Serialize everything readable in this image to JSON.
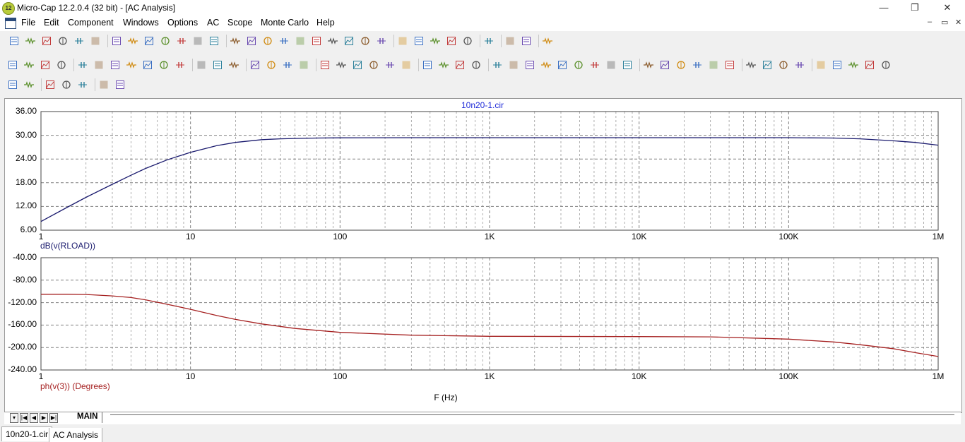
{
  "window": {
    "title": "Micro-Cap 12.2.0.4 (32 bit) - [AC Analysis]",
    "app_badge": "12"
  },
  "window_controls": {
    "minimize": "—",
    "maximize": "❐",
    "close": "✕"
  },
  "menu": {
    "items": [
      "File",
      "Edit",
      "Component",
      "Windows",
      "Options",
      "AC",
      "Scope",
      "Monte Carlo",
      "Help"
    ]
  },
  "mdi_controls": {
    "minimize": "–",
    "restore": "▭",
    "close": "✕"
  },
  "toolbar_icons": {
    "row1": [
      "new",
      "open",
      "save",
      "revert",
      "print-preview",
      "print",
      "undo",
      "redo",
      "cut",
      "copy",
      "paste",
      "delete",
      "select-all",
      "ground",
      "resistor",
      "capacitor",
      "inductor",
      "diode",
      "transistor",
      "opamp",
      "switch",
      "battery",
      "source",
      "component-list",
      "tile-horizontal",
      "tile-vertical",
      "cascade",
      "window-list",
      "calculator",
      "notes",
      "find",
      "help"
    ],
    "row2": [
      "select",
      "pan",
      "component",
      "info",
      "graph",
      "text-mode",
      "wire",
      "bus",
      "flag",
      "text",
      "paste-special",
      "run",
      "stop",
      "pause",
      "cursor-left",
      "cursor-right",
      "frame",
      "grid",
      "plot-1",
      "plot-2",
      "plot-3",
      "plot-4",
      "page-1",
      "page-2",
      "zoom-fit",
      "zoom-in-region",
      "zoom-out-region",
      "zoom-in-all",
      "properties",
      "peak",
      "valley",
      "high",
      "low",
      "inflection",
      "global-high",
      "global-low",
      "slope",
      "sep",
      "tag-v",
      "tag-h",
      "tag-point",
      "tag-text",
      "scale",
      "axis-1",
      "axis-2",
      "axis-3",
      "zoom-in",
      "zoom-out",
      "zoom-plot",
      "layout",
      "font",
      "color"
    ],
    "row3": [
      "align-left",
      "align-center",
      "align-right",
      "align-top",
      "align-middle",
      "align-bottom",
      "distribute"
    ]
  },
  "plot_title": "10n20-1.cir",
  "chart_data": [
    {
      "type": "line",
      "xscale": "log",
      "xlim": [
        1,
        1000000
      ],
      "ylim": [
        6,
        36
      ],
      "yticks": [
        "36.00",
        "30.00",
        "24.00",
        "18.00",
        "12.00",
        "6.00"
      ],
      "xticks": [
        "1",
        "10",
        "100",
        "1K",
        "10K",
        "100K",
        "1M"
      ],
      "ylabel": "dB(v(RLOAD))",
      "grid": true,
      "series": [
        {
          "name": "dB(v(RLOAD))",
          "color": "#1a1a6e",
          "x": [
            1,
            1.5,
            2,
            3,
            4,
            5,
            7,
            10,
            15,
            20,
            30,
            40,
            50,
            70,
            100,
            300,
            1000,
            10000,
            100000,
            200000,
            300000,
            500000,
            700000,
            1000000
          ],
          "y": [
            8.2,
            11.8,
            14.3,
            17.6,
            19.9,
            21.6,
            23.8,
            25.7,
            27.4,
            28.2,
            28.9,
            29.1,
            29.2,
            29.3,
            29.35,
            29.4,
            29.4,
            29.4,
            29.4,
            29.3,
            29.1,
            28.6,
            28.2,
            27.5
          ]
        }
      ]
    },
    {
      "type": "line",
      "xscale": "log",
      "xlim": [
        1,
        1000000
      ],
      "ylim": [
        -240,
        -40
      ],
      "yticks": [
        "-40.00",
        "-80.00",
        "-120.00",
        "-160.00",
        "-200.00",
        "-240.00"
      ],
      "xticks": [
        "1",
        "10",
        "100",
        "1K",
        "10K",
        "100K",
        "1M"
      ],
      "xlabel": "F (Hz)",
      "ylabel": "ph(v(3)) (Degrees)",
      "grid": true,
      "series": [
        {
          "name": "ph(v(3)) (Degrees)",
          "color": "#a52020",
          "x": [
            1,
            1.5,
            2,
            3,
            4,
            5,
            7,
            10,
            15,
            20,
            30,
            50,
            100,
            300,
            1000,
            10000,
            30000,
            100000,
            200000,
            300000,
            500000,
            700000,
            1000000
          ],
          "y": [
            -105,
            -105,
            -105.5,
            -108,
            -111,
            -115,
            -123,
            -132,
            -143,
            -150,
            -158,
            -166,
            -173,
            -178,
            -180,
            -180.5,
            -181,
            -185,
            -190,
            -195,
            -202,
            -209,
            -216
          ]
        }
      ]
    }
  ],
  "sheet": {
    "tab": "MAIN"
  },
  "doc_tabs": [
    "10n20-1.cir",
    "AC Analysis"
  ]
}
